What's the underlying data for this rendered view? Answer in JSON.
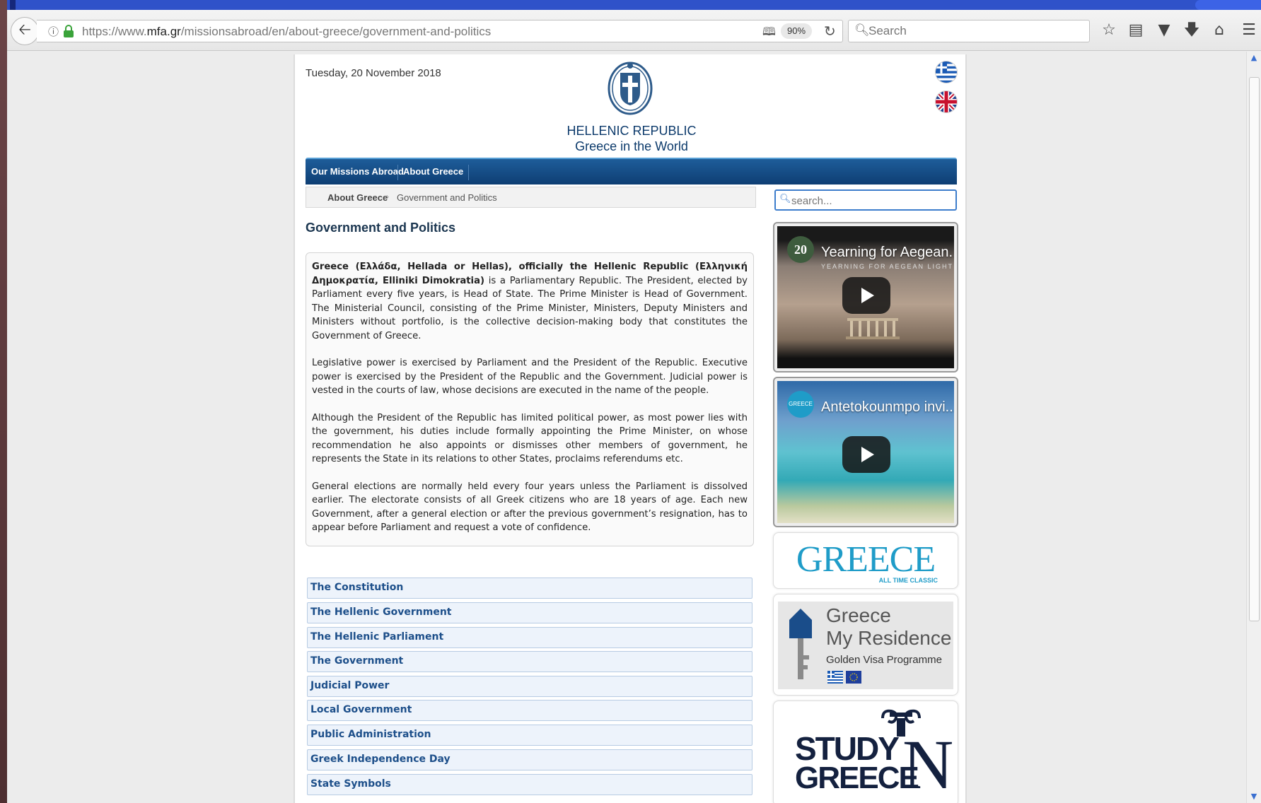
{
  "browser": {
    "url_prefix": "https://www.",
    "url_host": "mfa.gr",
    "url_path": "/missionsabroad/en/about-greece/government-and-politics",
    "zoom": "90%",
    "search_placeholder": "Search"
  },
  "header": {
    "date": "Tuesday, 20 November 2018",
    "title_line1": "HELLENIC REPUBLIC",
    "title_line2": "Greece in the World"
  },
  "menu": {
    "items": [
      "Our Missions Abroad",
      "About Greece"
    ]
  },
  "breadcrumb": {
    "parent": "About Greece",
    "current": "Government and Politics"
  },
  "main": {
    "heading": "Government and Politics",
    "p1_bold": "Greece (Ελλάδα, Hellada or Hellas), officially the Hellenic Republic (Ελληνική Δημοκρατία, Elliniki Dimokratia)",
    "p1_rest": " is a Parliamentary Republic. The President, elected by Parliament every five years, is Head of State. The Prime Minister is Head of Government. The Ministerial Council, consisting of the Prime Minister, Ministers, Deputy Ministers and Ministers without portfolio, is the collective decision-making body that constitutes the Government of Greece.",
    "p2": "Legislative power is exercised by Parliament and the President of the Republic. Executive power is exercised by the President of the Republic and the Government. Judicial power is vested in the courts of law, whose decisions are executed in the name of the people.",
    "p3": "Although the President of the Republic has limited political power, as most power lies with the government, his duties include formally appointing the Prime Minister, on whose recommendation he also appoints or dismisses other members of government, he represents the State in its relations to other States, proclaims referendums etc.",
    "p4": "General elections are normally held every four years unless the Parliament is dissolved earlier. The electorate consists of all Greek citizens who are 18 years of age. Each new Government, after a general election or after the previous government’s resignation, has to appear before Parliament and request a vote of confidence.",
    "sections": [
      "The Constitution",
      "The Hellenic Government",
      "The Hellenic Parliament",
      "The Government",
      "Judicial Power",
      "Local Government",
      "Public Administration",
      "Greek Independence Day",
      "State Symbols"
    ]
  },
  "sidebar": {
    "search_placeholder": "search...",
    "video1_title": "Yearning for Aegean...",
    "video1_sub": "YEARNING FOR AEGEAN LIGHT",
    "video1_channel": "20",
    "video2_title": "Antetokounmpo invi...",
    "video2_channel": "GREECE",
    "banner_greece": "GREECE",
    "banner_greece_sub": "ALL TIME CLASSIC",
    "residence_l1": "Greece",
    "residence_l2": "My Residence",
    "residence_l3": "Golden Visa Programme",
    "study_l1": "STUDY",
    "study_l2": "GREECE",
    "study_n": "N"
  }
}
